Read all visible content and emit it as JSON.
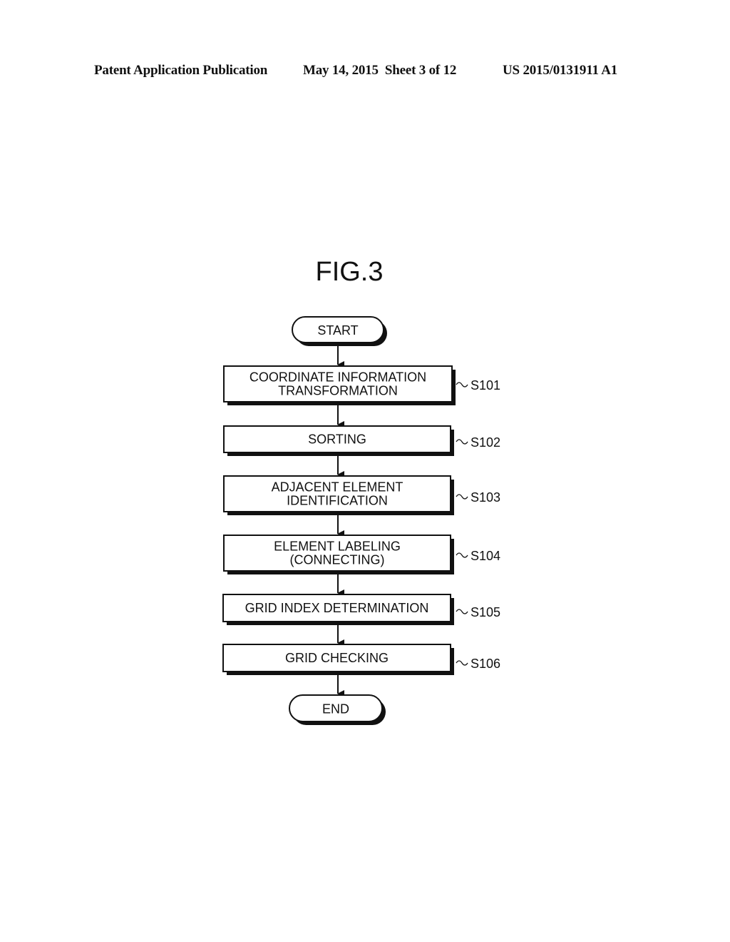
{
  "header": {
    "publication": "Patent Application Publication",
    "date_sheet": "May 14, 2015  Sheet 3 of 12",
    "number": "US 2015/0131911 A1"
  },
  "figure": {
    "title": "FIG.3",
    "start": "START",
    "end": "END",
    "steps": [
      {
        "id": "S101",
        "lines": [
          "COORDINATE INFORMATION",
          "TRANSFORMATION"
        ]
      },
      {
        "id": "S102",
        "lines": [
          "SORTING"
        ]
      },
      {
        "id": "S103",
        "lines": [
          "ADJACENT ELEMENT",
          "IDENTIFICATION"
        ]
      },
      {
        "id": "S104",
        "lines": [
          "ELEMENT LABELING",
          "(CONNECTING)"
        ]
      },
      {
        "id": "S105",
        "lines": [
          "GRID INDEX DETERMINATION"
        ]
      },
      {
        "id": "S106",
        "lines": [
          "GRID CHECKING"
        ]
      }
    ]
  }
}
